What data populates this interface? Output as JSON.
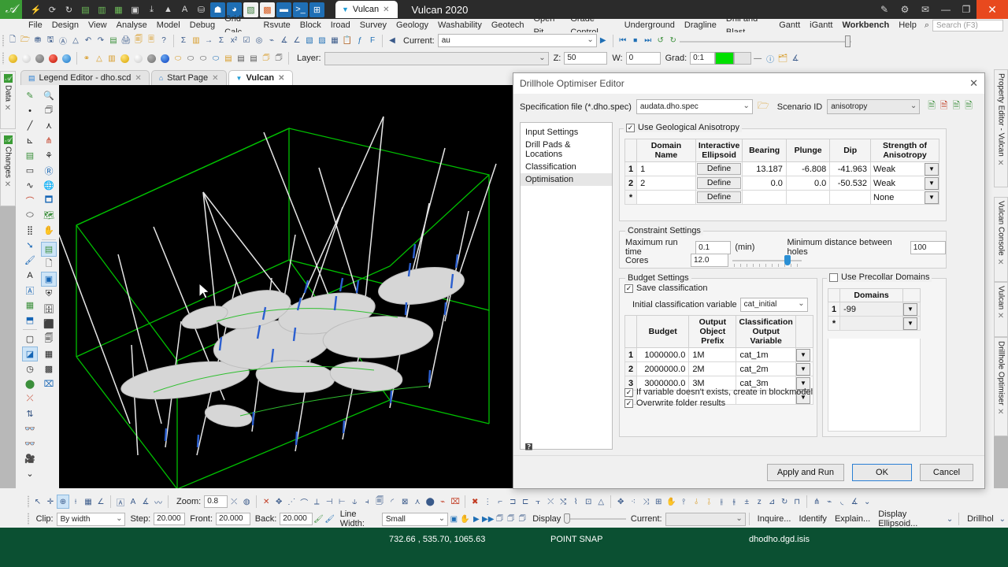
{
  "titlebar": {
    "app_title": "Vulcan 2020",
    "doc_tab": "Vulcan",
    "doc_tab_close": "✕",
    "icons": [
      "lightning-icon",
      "compass-icon",
      "refresh-icon",
      "report-icon",
      "book-icon",
      "script-icon",
      "table-icon",
      "import-icon",
      "surface-icon",
      "font-icon",
      "network-icon",
      "person-icon",
      "globe-icon",
      "document-icon",
      "office-icon",
      "chat-icon",
      "terminal-icon",
      "grid-icon"
    ],
    "right_icons": [
      "wand-icon",
      "gear-icon",
      "mail-icon"
    ],
    "minimize": "—",
    "maximize": "❐",
    "close": "✕"
  },
  "menubar": {
    "items": [
      "File",
      "Design",
      "View",
      "Analyse",
      "Model",
      "Debug",
      "Grid Calc",
      "Rsvute",
      "Block",
      "Iroad",
      "Survey",
      "Geology",
      "Washability",
      "Geotech",
      "Open Pit",
      "Grade Control",
      "Underground",
      "Dragline",
      "Drill and Blast",
      "Gantt",
      "iGantt",
      "Workbench"
    ],
    "bold_item": "Workbench",
    "help": "Help",
    "search_placeholder": "Search (F3)"
  },
  "toolbar1": {
    "current_label": "Current:",
    "current_value": "au",
    "prev_icon": "step-back-icon",
    "play_icon": "play-icon",
    "rew_icon": "rewind-icon",
    "stop_icon": "stop-icon",
    "ff_icon": "fast-forward-icon",
    "loop_icon": "loop-icon",
    "reload_icon": "reload-icon"
  },
  "toolbar2": {
    "layer_label": "Layer:",
    "layer_value": "",
    "z_label": "Z:",
    "z_value": "50",
    "w_label": "W:",
    "w_value": "0",
    "grad_label": "Grad:",
    "grad_value": "0:1",
    "swatch_color": "#00e000"
  },
  "tabstrip": {
    "tabs": [
      {
        "label": "Legend Editor - dho.scd",
        "icon": "legend-icon",
        "close": "✕",
        "active": false
      },
      {
        "label": "Start Page",
        "icon": "home-icon",
        "close": "✕",
        "active": false
      },
      {
        "label": "Vulcan",
        "icon": "vulcan-icon",
        "close": "✕",
        "active": true
      }
    ]
  },
  "left_docks": [
    {
      "label": "Data",
      "close": "✕"
    },
    {
      "label": "Changes",
      "close": "✕"
    }
  ],
  "right_docks": [
    {
      "label": "Property Editor - Vulcan",
      "close": "✕"
    },
    {
      "label": "Vulcan Console",
      "close": "✕"
    },
    {
      "label": "Vulcan",
      "close": "✕"
    },
    {
      "label": "Drillhole Optimiser",
      "close": "✕"
    }
  ],
  "bottom_toolbar": {
    "zoom_label": "Zoom:",
    "zoom_value": "0.8",
    "clip_label": "Clip:",
    "clip_value": "By width",
    "step_label": "Step:",
    "step_value": "20.000",
    "front_label": "Front:",
    "front_value": "20.000",
    "back_label": "Back:",
    "back_value": "20.000",
    "linewidth_label": "Line Width:",
    "linewidth_value": "Small",
    "display_label": "Display",
    "current_label": "Current:",
    "current_value": "",
    "actions": [
      "Inquire...",
      "Identify",
      "Explain...",
      "Display Ellipsoid..."
    ],
    "drillhole_label": "Drillhol"
  },
  "statusbar": {
    "coordinates": "732.66 , 535.70, 1065.63",
    "snap_mode": "POINT SNAP",
    "filename": "dhodho.dgd.isis",
    "background": "#0b5032"
  },
  "dialog": {
    "title": "Drillhole Optimiser Editor",
    "close": "✕",
    "spec_label": "Specification file (*.dho.spec)",
    "spec_value": "audata.dho.spec",
    "folder_icon": "folder-open-icon",
    "scenario_label": "Scenario ID",
    "scenario_value": "anisotropy",
    "scenario_icons": [
      "scenario-new-icon",
      "scenario-delete-icon",
      "scenario-copy-icon",
      "scenario-save-icon"
    ],
    "nav_items": [
      "Input Settings",
      "Drill Pads & Locations",
      "Classification",
      "Optimisation"
    ],
    "nav_selected": "Optimisation",
    "anisotropy": {
      "group_label": "Use Geological Anisotropy",
      "checked": true,
      "columns": [
        "",
        "Domain Name",
        "Interactive Ellipsoid",
        "Bearing",
        "Plunge",
        "Dip",
        "Strength of Anisotropy"
      ],
      "rows": [
        {
          "n": "1",
          "domain": "1",
          "ellipsoid": "Define",
          "bearing": "13.187",
          "plunge": "-6.808",
          "dip": "-41.963",
          "strength": "Weak"
        },
        {
          "n": "2",
          "domain": "2",
          "ellipsoid": "Define",
          "bearing": "0.0",
          "plunge": "0.0",
          "dip": "-50.532",
          "strength": "Weak"
        },
        {
          "n": "*",
          "domain": "",
          "ellipsoid": "Define",
          "bearing": "",
          "plunge": "",
          "dip": "",
          "strength": "None"
        }
      ]
    },
    "constraints": {
      "group_label": "Constraint Settings",
      "max_runtime_label": "Maximum run time",
      "max_runtime_value": "0.1",
      "max_runtime_units": "(min)",
      "min_distance_label": "Minimum distance between holes",
      "min_distance_value": "100",
      "cores_label": "Cores",
      "cores_value": "12.0"
    },
    "budget": {
      "group_label": "Budget Settings",
      "save_classification_label": "Save classification",
      "save_classification_checked": true,
      "initial_var_label": "Initial classification variable",
      "initial_var_value": "cat_initial",
      "columns": [
        "",
        "Budget",
        "Output Object Prefix",
        "Classification Output Variable",
        ""
      ],
      "rows": [
        {
          "n": "1",
          "budget": "1000000.0",
          "prefix": "1M",
          "variable": "cat_1m"
        },
        {
          "n": "2",
          "budget": "2000000.0",
          "prefix": "2M",
          "variable": "cat_2m"
        },
        {
          "n": "3",
          "budget": "3000000.0",
          "prefix": "3M",
          "variable": "cat_3m"
        },
        {
          "n": "*",
          "budget": "",
          "prefix": "",
          "variable": ""
        }
      ],
      "create_var_label": "If variable doesn't exists, create in blockmodel",
      "create_var_checked": true,
      "overwrite_label": "Overwrite folder results",
      "overwrite_checked": true
    },
    "precollar": {
      "group_label": "Use Precollar Domains",
      "checked": false,
      "column_header": "Domains",
      "rows": [
        {
          "n": "1",
          "value": "-99"
        },
        {
          "n": "*",
          "value": ""
        }
      ]
    },
    "help_icon": "help-icon",
    "buttons": {
      "apply_and_run": "Apply and Run",
      "ok": "OK",
      "cancel": "Cancel"
    }
  },
  "viewport": {
    "background": "#000000",
    "wireframe_color": "#00c000",
    "drillhole_color": "#e8e8e8",
    "sample_color": "#2b5fd0",
    "solid_color": "#d4d4d4"
  }
}
